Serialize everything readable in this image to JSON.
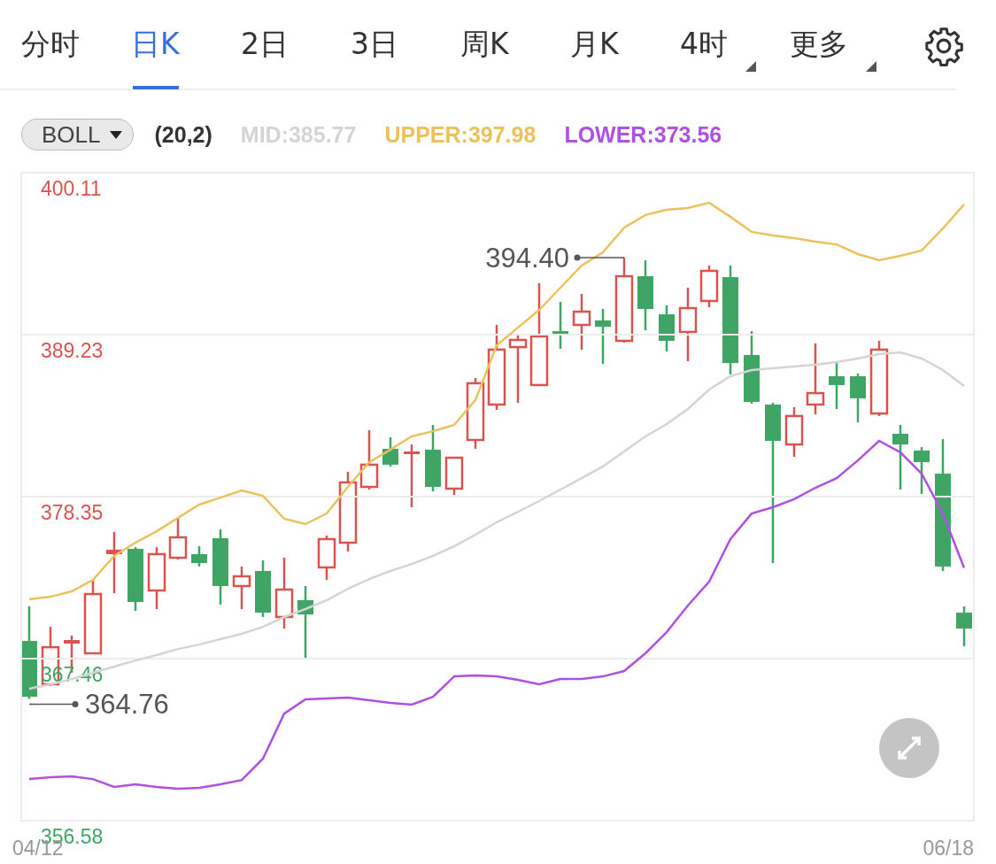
{
  "tabs": [
    {
      "label": "分时",
      "selected": false,
      "dropdown": false
    },
    {
      "label": "日K",
      "selected": true,
      "dropdown": false
    },
    {
      "label": "2日",
      "selected": false,
      "dropdown": false
    },
    {
      "label": "3日",
      "selected": false,
      "dropdown": false
    },
    {
      "label": "周K",
      "selected": false,
      "dropdown": false
    },
    {
      "label": "月K",
      "selected": false,
      "dropdown": false
    },
    {
      "label": "4时",
      "selected": false,
      "dropdown": true
    },
    {
      "label": "更多",
      "selected": false,
      "dropdown": true
    }
  ],
  "indicator": {
    "name": "BOLL",
    "params": "(20,2)",
    "readings": [
      {
        "label": "MID:385.77",
        "color": "#d4d4d4"
      },
      {
        "label": "UPPER:397.98",
        "color": "#ecc15c"
      },
      {
        "label": "LOWER:373.56",
        "color": "#b050e0"
      }
    ]
  },
  "chart": {
    "dates": [
      "04/12",
      "06/18"
    ],
    "chart_data": {
      "type": "line",
      "ylim": [
        356.58,
        400.11
      ],
      "grid": true,
      "yticks": [
        400.11,
        389.23,
        378.35,
        367.46,
        356.58
      ],
      "series": [
        {
          "color": "#ecc15c",
          "values": [
            371.45,
            371.62,
            371.98,
            372.75,
            374.36,
            375.25,
            376.02,
            376.92,
            377.81,
            378.28,
            378.76,
            378.4,
            376.86,
            376.5,
            377.21,
            379.0,
            380.66,
            381.5,
            382.39,
            382.74,
            383.16,
            384.83,
            388.51,
            389.7,
            390.89,
            392.38,
            393.87,
            394.76,
            396.42,
            397.26,
            397.61,
            397.73,
            398.09,
            397.14,
            396.13,
            395.89,
            395.71,
            395.47,
            395.29,
            394.64,
            394.22,
            394.52,
            394.88,
            396.36,
            397.98
          ]
        },
        {
          "color": "#d4d4d4",
          "values": [
            365.44,
            365.74,
            366.09,
            366.51,
            366.93,
            367.34,
            367.7,
            368.11,
            368.41,
            368.77,
            369.13,
            369.6,
            370.26,
            370.79,
            371.39,
            372.16,
            372.81,
            373.35,
            373.82,
            374.36,
            375.01,
            375.79,
            376.62,
            377.33,
            378.05,
            378.82,
            379.59,
            380.37,
            381.38,
            382.39,
            383.22,
            384.23,
            385.54,
            386.43,
            386.85,
            386.97,
            387.09,
            387.21,
            387.38,
            387.62,
            387.92,
            388.04,
            387.62,
            386.85,
            385.77
          ]
        },
        {
          "color": "#b050e0",
          "values": [
            359.37,
            359.49,
            359.55,
            359.37,
            358.84,
            359.02,
            358.84,
            358.72,
            358.78,
            359.02,
            359.31,
            360.74,
            363.77,
            364.73,
            364.78,
            364.84,
            364.67,
            364.49,
            364.37,
            364.9,
            366.27,
            366.33,
            366.27,
            366.03,
            365.74,
            366.09,
            366.09,
            366.27,
            366.63,
            367.82,
            369.24,
            371.03,
            372.63,
            375.49,
            377.21,
            377.63,
            378.17,
            378.94,
            379.59,
            380.78,
            382.09,
            381.32,
            379.89,
            377.21,
            373.56
          ]
        }
      ],
      "annotations": [
        "394.40",
        "364.76"
      ]
    }
  }
}
